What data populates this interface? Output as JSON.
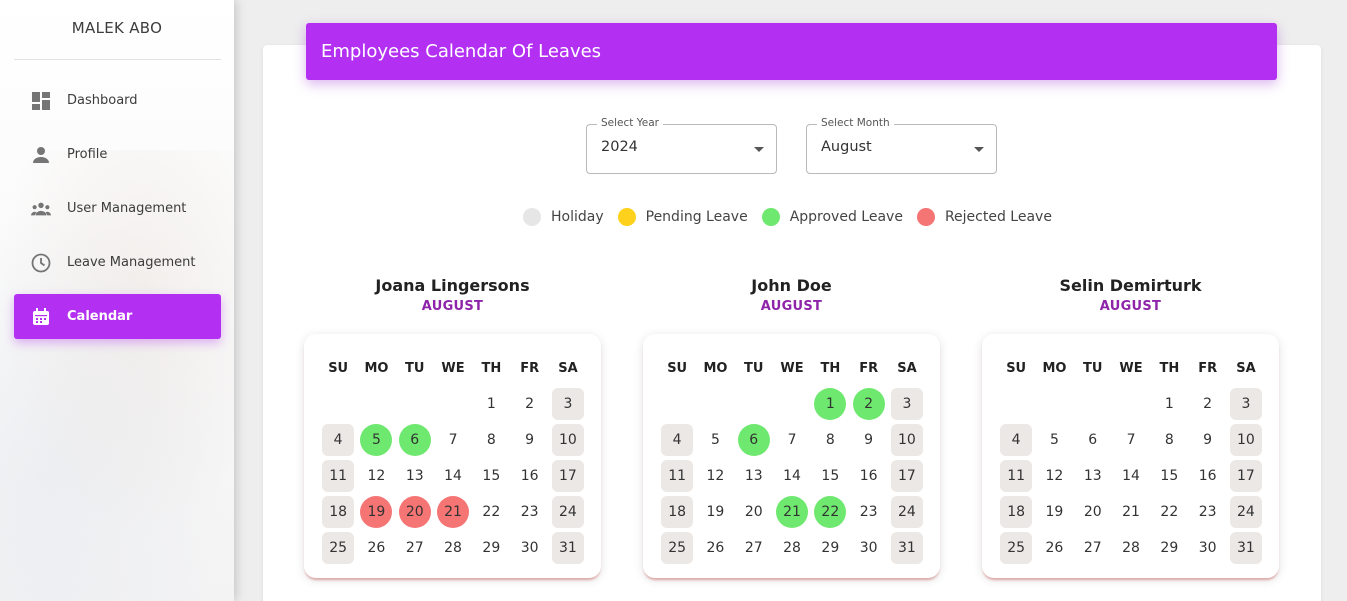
{
  "sidebar": {
    "brand": "MALEK ABO",
    "items": [
      {
        "label": "Dashboard",
        "icon": "dashboard-icon"
      },
      {
        "label": "Profile",
        "icon": "person-icon"
      },
      {
        "label": "User Management",
        "icon": "people-icon"
      },
      {
        "label": "Leave Management",
        "icon": "clock-icon"
      },
      {
        "label": "Calendar",
        "icon": "calendar-icon",
        "active": true
      }
    ]
  },
  "header": {
    "title": "Employees Calendar Of Leaves"
  },
  "filters": {
    "year": {
      "label": "Select Year",
      "value": "2024"
    },
    "month": {
      "label": "Select Month",
      "value": "August"
    }
  },
  "legend": [
    {
      "label": "Holiday",
      "color": "#e6e6e6"
    },
    {
      "label": "Pending Leave",
      "color": "#fdd11c"
    },
    {
      "label": "Approved Leave",
      "color": "#6ee86e"
    },
    {
      "label": "Rejected Leave",
      "color": "#f57474"
    }
  ],
  "weekdays": [
    "SU",
    "MO",
    "TU",
    "WE",
    "TH",
    "FR",
    "SA"
  ],
  "calendar": {
    "first_weekday_index": 4,
    "days_in_month": 31
  },
  "employees": [
    {
      "name": "Joana Lingersons",
      "month": "AUGUST",
      "approved": [
        5,
        6
      ],
      "rejected": [
        19,
        20,
        21
      ],
      "pending": []
    },
    {
      "name": "John Doe",
      "month": "AUGUST",
      "approved": [
        1,
        2,
        6,
        21,
        22
      ],
      "rejected": [],
      "pending": []
    },
    {
      "name": "Selin Demirturk",
      "month": "AUGUST",
      "approved": [],
      "rejected": [],
      "pending": []
    }
  ]
}
